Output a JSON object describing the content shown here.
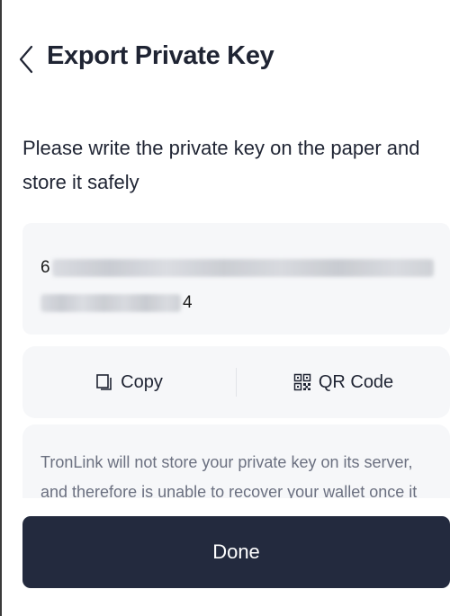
{
  "header": {
    "title": "Export Private Key",
    "back_icon": "chevron-left-icon"
  },
  "instruction": "Please write the private key on the paper and store it safely",
  "private_key": {
    "line1_visible_start": "6",
    "line2_visible_end": "4",
    "masked": true
  },
  "actions": {
    "copy": {
      "label": "Copy",
      "icon": "copy-icon"
    },
    "qr": {
      "label": "QR Code",
      "icon": "qr-code-icon"
    }
  },
  "notice": {
    "text": "TronLink will not store your private key on its server, and therefore is unable to recover your wallet once it is"
  },
  "done_button": {
    "label": "Done"
  },
  "colors": {
    "primary_dark": "#232a3e",
    "card_bg": "#f6f7f9",
    "text_primary": "#1f2433",
    "text_secondary": "#6b7080"
  }
}
